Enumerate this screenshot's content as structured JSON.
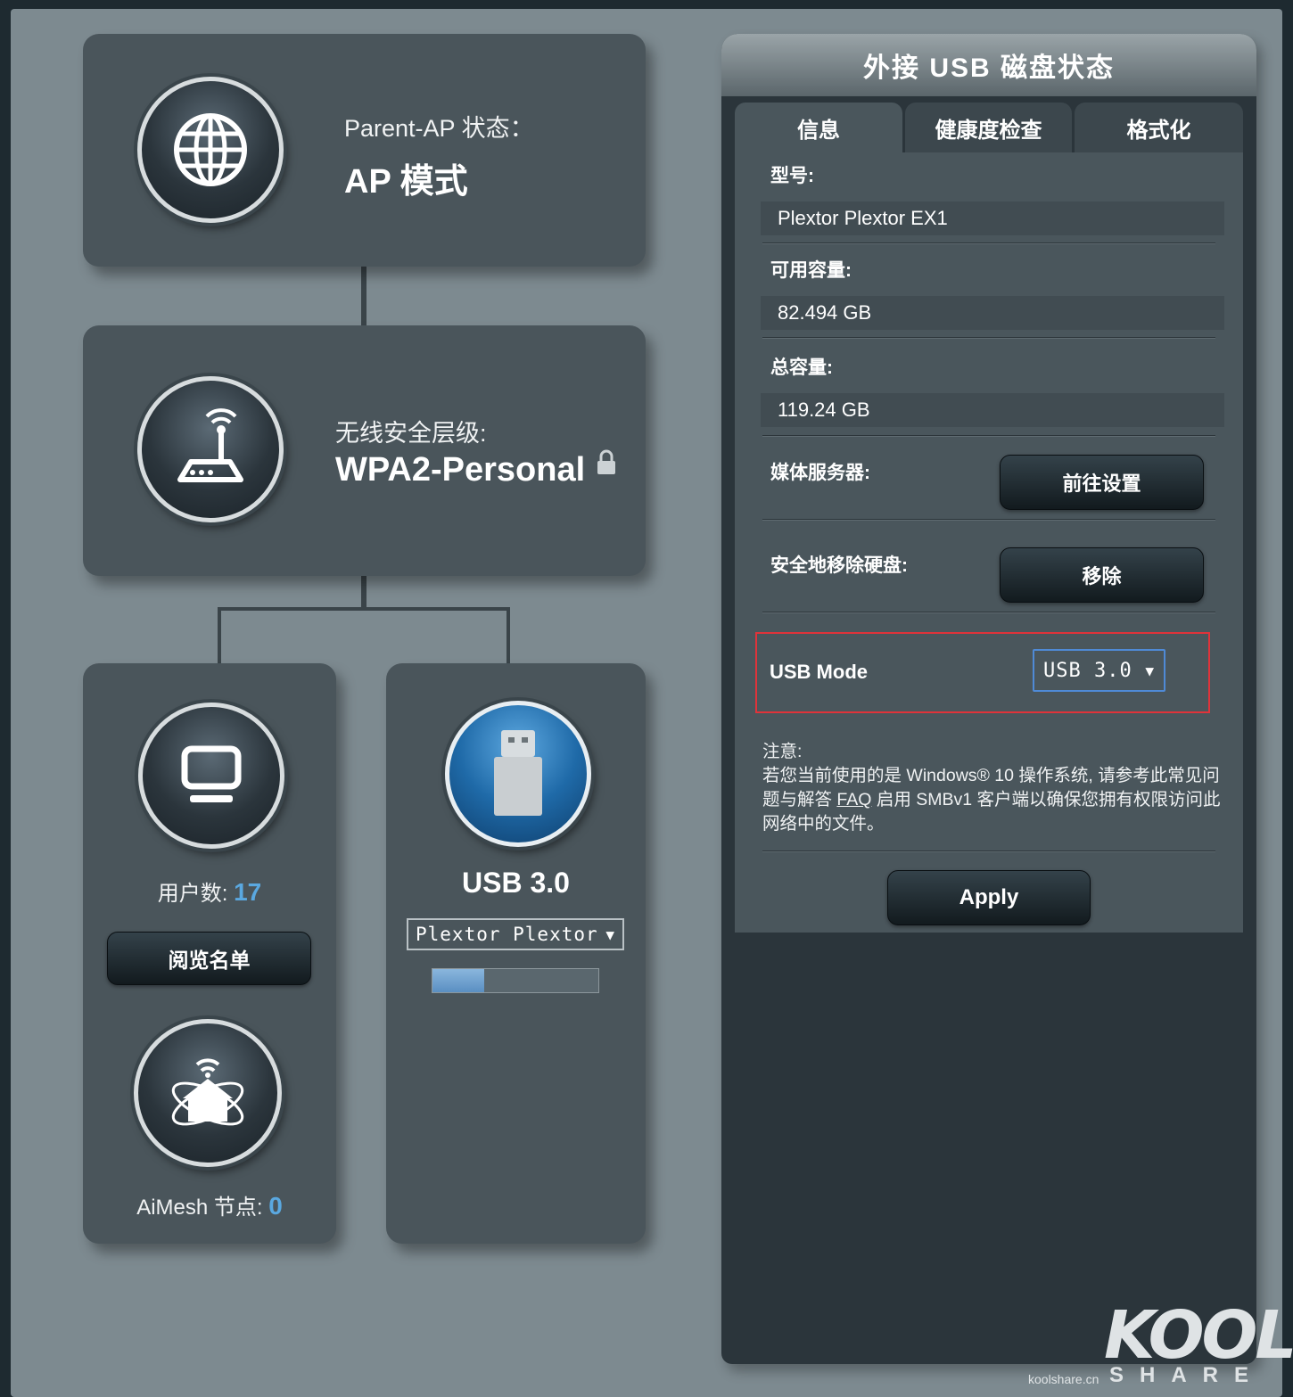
{
  "network_map": {
    "parent_ap": {
      "label": "Parent-AP 状态：",
      "value": "AP 模式",
      "icon": "globe-icon"
    },
    "security": {
      "label": "无线安全层级:",
      "value": "WPA2-Personal",
      "icon": "router-icon",
      "lock_icon": "lock-icon"
    },
    "clients": {
      "label": "用户数:",
      "count": "17",
      "button": "阅览名单",
      "icon": "computer-icon"
    },
    "aimesh": {
      "label": "AiMesh 节点:",
      "count": "0",
      "icon": "aimesh-home-icon"
    },
    "usb": {
      "title": "USB 3.0",
      "selected_device": "Plextor Plextor",
      "usage_fraction": 0.31,
      "icon": "usb-drive-icon"
    }
  },
  "usb_panel": {
    "title": "外接 USB 磁盘状态",
    "tabs": [
      {
        "label": "信息",
        "active": true
      },
      {
        "label": "健康度检查",
        "active": false
      },
      {
        "label": "格式化",
        "active": false
      }
    ],
    "model_label": "型号:",
    "model_value": "Plextor Plextor EX1",
    "available_label": "可用容量:",
    "available_value": "82.494 GB",
    "total_label": "总容量:",
    "total_value": "119.24 GB",
    "media_server_label": "媒体服务器:",
    "media_server_button": "前往设置",
    "eject_label": "安全地移除硬盘:",
    "eject_button": "移除",
    "usb_mode_label": "USB Mode",
    "usb_mode_value": "USB 3.0",
    "note_title": "注意:",
    "note_text_1": "若您当前使用的是 Windows® 10 操作系统, 请参考此常见问题与解答 ",
    "note_link": "FAQ",
    "note_text_2": " 启用 SMBv1 客户端以确保您拥有权限访问此网络中的文件。",
    "apply_button": "Apply"
  },
  "logo": {
    "brand": "KOOL",
    "sub": "SHARE",
    "site": "koolshare.cn"
  },
  "colors": {
    "accent_blue": "#5aa8e0",
    "highlight_red": "#e0333a",
    "select_border": "#4f8ad6"
  }
}
